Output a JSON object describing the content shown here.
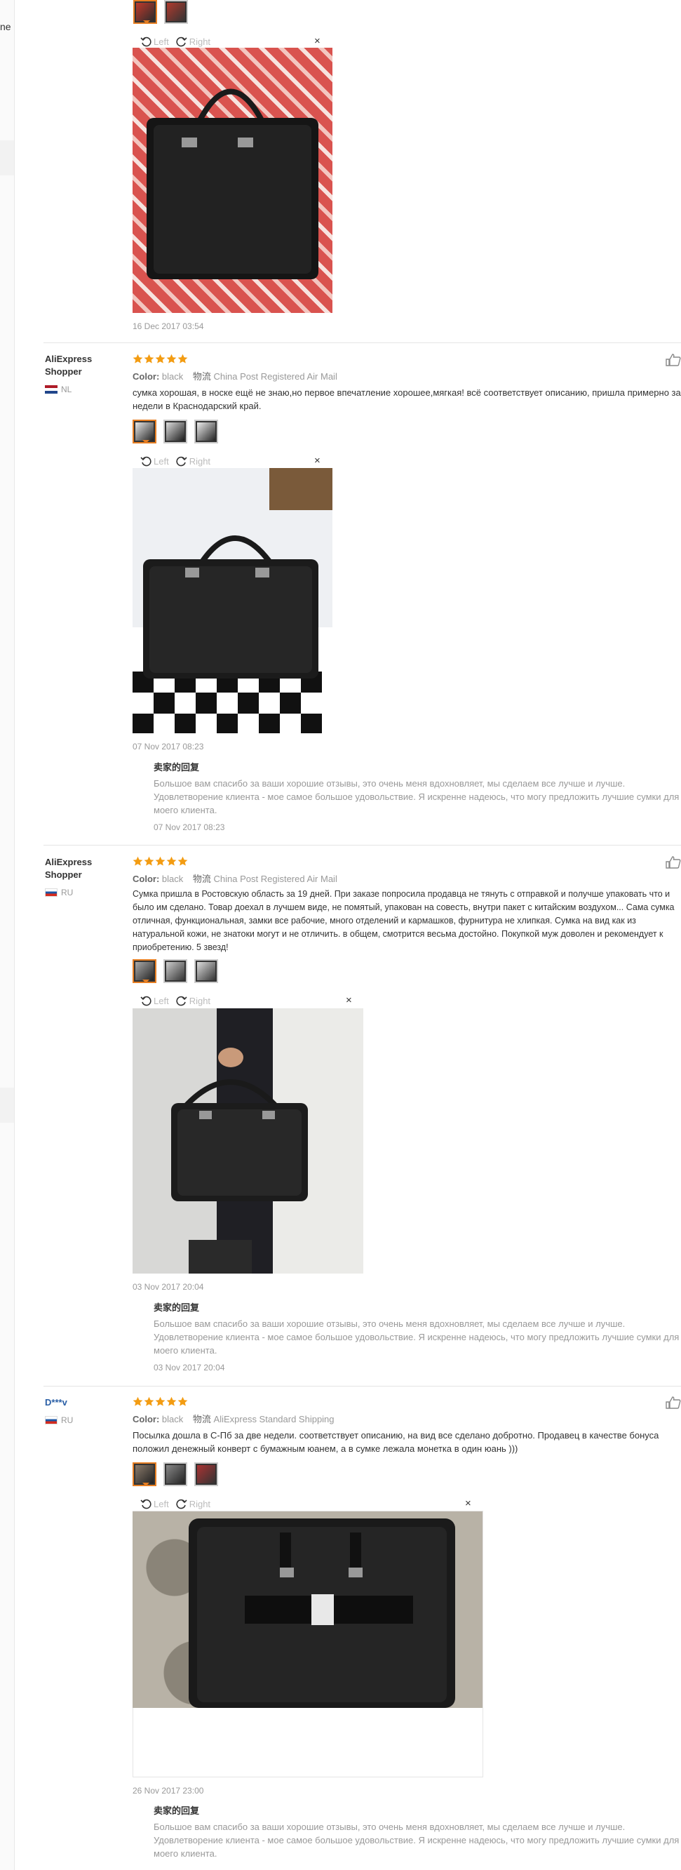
{
  "rail": {
    "text1": "ne",
    "text2": ""
  },
  "viewer": {
    "left_label": "Left",
    "right_label": "Right",
    "close": "×"
  },
  "reviews": [
    {
      "date": "16 Dec 2017 03:54"
    },
    {
      "user": "AliExpress Shopper",
      "country": "NL",
      "color_label": "Color:",
      "color": "black",
      "ship_label": "物流",
      "shipping": "China Post Registered Air Mail",
      "text": "сумка хорошая, в носке ещё не знаю,но первое впечатление хорошее,мягкая! всё соответствует описанию, пришла примерно за 3 недели в Краснодарский край.",
      "date": "07 Nov 2017 08:23",
      "seller_title": "卖家的回复",
      "seller_text": "Большое вам спасибо за ваши хорошие отзывы, это очень меня вдохновляет, мы сделаем все лучше и лучше. Удовлетворение клиента - мое самое большое удовольствие. Я искренне надеюсь, что могу предложить лучшие сумки для моего клиента.",
      "seller_date": "07 Nov 2017 08:23"
    },
    {
      "user": "AliExpress Shopper",
      "country": "RU",
      "color_label": "Color:",
      "color": "black",
      "ship_label": "物流",
      "shipping": "China Post Registered Air Mail",
      "text": "Сумка пришла в Ростовскую область за 19 дней. При заказе попросила продавца не тянуть с отправкой и получше упаковать что и было им сделано. Товар доехал в лучшем виде, не помятый, упакован на совесть, внутри пакет с китайским воздухом... Сама сумка отличная, функциональная, замки все рабочие, много отделений и кармашков, фурнитура не хлипкая. Сумка на вид как из натуральной кожи, не знатоки могут и не отличить. в общем, смотрится весьма достойно. Покупкой муж доволен и рекомендует к приобретению. 5 звезд!",
      "date": "03 Nov 2017 20:04",
      "seller_title": "卖家的回复",
      "seller_text": "Большое вам спасибо за ваши хорошие отзывы, это очень меня вдохновляет, мы сделаем все лучше и лучше. Удовлетворение клиента - мое самое большое удовольствие. Я искренне надеюсь, что могу предложить лучшие сумки для моего клиента.",
      "seller_date": "03 Nov 2017 20:04"
    },
    {
      "user": "D***v",
      "country": "RU",
      "color_label": "Color:",
      "color": "black",
      "ship_label": "物流",
      "shipping": "AliExpress Standard Shipping",
      "text": "Посылка дошла в С-Пб за две недели. соответствует описанию, на вид все сделано добротно. Продавец в качестве бонуса положил денежный конверт с бумажным юанем, а в сумке лежала монетка в один юань )))",
      "date": "26 Nov 2017 23:00",
      "seller_title": "卖家的回复",
      "seller_text": "Большое вам спасибо за ваши хорошие отзывы, это очень меня вдохновляет, мы сделаем все лучше и лучше. Удовлетворение клиента - мое самое большое удовольствие. Я искренне надеюсь, что могу предложить лучшие сумки для моего клиента."
    }
  ],
  "colors": {
    "accent": "#e67e22",
    "star": "#f39c12",
    "user_blue": "#2a5fa6"
  },
  "icons": [
    "rotate-left-icon",
    "rotate-right-icon",
    "close-icon",
    "star-icon",
    "thumbs-up-icon",
    "flag-icon"
  ]
}
